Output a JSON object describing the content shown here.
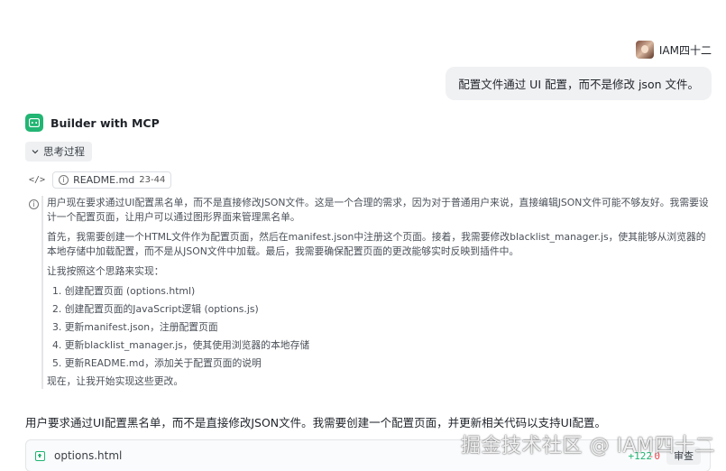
{
  "user": {
    "name": "IAM四十二",
    "message": "配置文件通过 UI 配置，而不是修改 json 文件。"
  },
  "bot": {
    "name": "Builder with MCP"
  },
  "thinking": {
    "toggle_label": "思考过程",
    "code_icon": "</>",
    "file_ref": {
      "name": "README.md",
      "range": "23-44"
    },
    "paragraphs": [
      "用户现在要求通过UI配置黑名单，而不是直接修改JSON文件。这是一个合理的需求，因为对于普通用户来说，直接编辑JSON文件可能不够友好。我需要设计一个配置页面，让用户可以通过图形界面来管理黑名单。",
      "首先，我需要创建一个HTML文件作为配置页面，然后在manifest.json中注册这个页面。接着，我需要修改blacklist_manager.js，使其能够从浏览器的本地存储中加载配置，而不是从JSON文件中加载。最后，我需要确保配置页面的更改能够实时反映到插件中。",
      "让我按照这个思路来实现："
    ],
    "steps": [
      "1. 创建配置页面 (options.html)",
      "2. 创建配置页面的JavaScript逻辑 (options.js)",
      "3. 更新manifest.json，注册配置页面",
      "4. 更新blacklist_manager.js，使其使用浏览器的本地存储",
      "5. 更新README.md，添加关于配置页面的说明"
    ],
    "closing": "现在，让我开始实现这些更改。"
  },
  "response": "用户要求通过UI配置黑名单，而不是直接修改JSON文件。我需要创建一个配置页面，并更新相关代码以支持UI配置。",
  "file_card": {
    "name": "options.html",
    "added": "+122",
    "removed": "-0",
    "button": "审查"
  },
  "watermark": "掘金技术社区 @ IAM四十二",
  "colors": {
    "accent_green": "#22b573",
    "delete_red": "#e5484d",
    "bubble_bg": "#f0f1f3"
  }
}
